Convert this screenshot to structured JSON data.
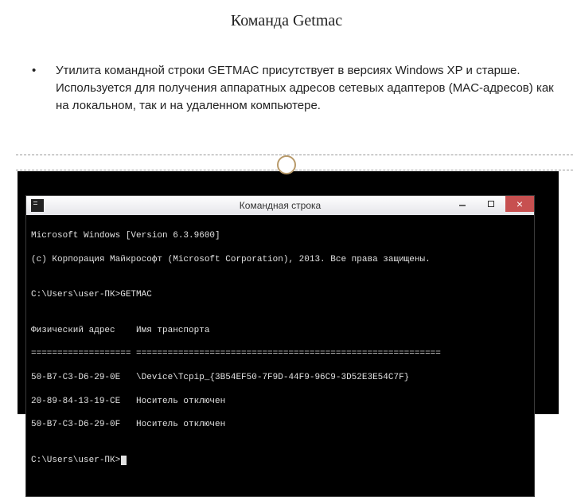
{
  "title": "Команда Getmac",
  "description": "Утилита командной строки GETMAC присутствует в версиях Windows XP и старше. Используется для получения аппаратных адресов сетевых адаптеров (MAC-адресов) как на локальном, так и на удаленном компьютере.",
  "terminal": {
    "window_title": "Командная строка",
    "lines": {
      "l0": "Microsoft Windows [Version 6.3.9600]",
      "l1": "(c) Корпорация Майкрософт (Microsoft Corporation), 2013. Все права защищены.",
      "l2": "",
      "l3": "C:\\Users\\user-ПК>GETMAC",
      "l4": "",
      "l5": "Физический адрес    Имя транспорта",
      "l6": "=================== ==========================================================",
      "l7": "50-B7-C3-D6-29-0E   \\Device\\Tcpip_{3B54EF50-7F9D-44F9-96C9-3D52E3E54C7F}",
      "l8": "20-89-84-13-19-CE   Носитель отключен",
      "l9": "50-B7-C3-D6-29-0F   Носитель отключен",
      "l10": "",
      "l11": "C:\\Users\\user-ПК>"
    }
  }
}
